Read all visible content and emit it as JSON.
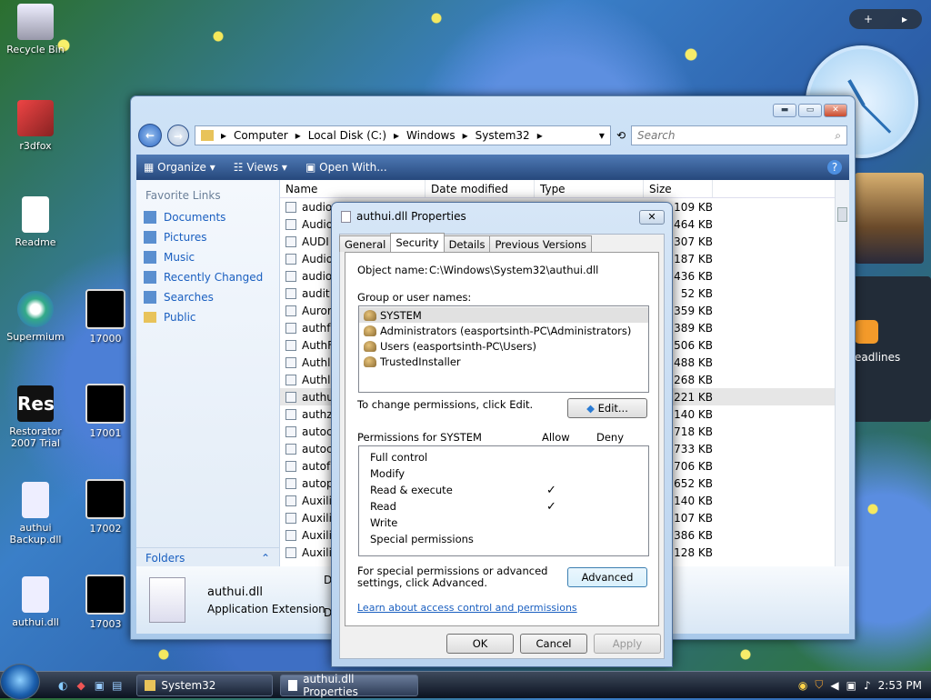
{
  "desktop": {
    "icons": [
      {
        "label": "Recycle Bin"
      },
      {
        "label": "r3dfox"
      },
      {
        "label": "Readme"
      },
      {
        "label": "Supermium"
      },
      {
        "label": "17000"
      },
      {
        "label": "Restorator 2007 Trial"
      },
      {
        "label": "17001"
      },
      {
        "label": "authui Backup.dll"
      },
      {
        "label": "17002"
      },
      {
        "label": "authui.dll"
      },
      {
        "label": "17003"
      }
    ]
  },
  "explorer": {
    "breadcrumb": [
      "Computer",
      "Local Disk (C:)",
      "Windows",
      "System32"
    ],
    "search_placeholder": "Search",
    "toolbar": {
      "organize": "Organize",
      "views": "Views",
      "open_with": "Open With..."
    },
    "favorites_title": "Favorite Links",
    "favorites": [
      "Documents",
      "Pictures",
      "Music",
      "Recently Changed",
      "Searches",
      "Public"
    ],
    "folders": "Folders",
    "columns": {
      "name": "Name",
      "date": "Date modified",
      "type": "Type",
      "size": "Size"
    },
    "files": [
      {
        "name": "audio",
        "size": "109 KB"
      },
      {
        "name": "Audio",
        "size": "464 KB"
      },
      {
        "name": "AUDI",
        "size": "307 KB"
      },
      {
        "name": "Audio",
        "size": "187 KB"
      },
      {
        "name": "audio",
        "size": "436 KB"
      },
      {
        "name": "audit",
        "size": "52 KB"
      },
      {
        "name": "Auror",
        "size": "1,359 KB"
      },
      {
        "name": "authf",
        "size": "389 KB"
      },
      {
        "name": "AuthF",
        "size": "506 KB"
      },
      {
        "name": "Authl",
        "size": "4,488 KB"
      },
      {
        "name": "Authl",
        "size": "268 KB"
      },
      {
        "name": "authu",
        "size": "2,221 KB"
      },
      {
        "name": "authz",
        "size": "140 KB"
      },
      {
        "name": "autoc",
        "size": "718 KB"
      },
      {
        "name": "autoc",
        "size": "733 KB"
      },
      {
        "name": "autof",
        "size": "706 KB"
      },
      {
        "name": "autop",
        "size": "652 KB"
      },
      {
        "name": "Auxili",
        "size": "140 KB"
      },
      {
        "name": "Auxili",
        "size": "107 KB"
      },
      {
        "name": "Auxili",
        "size": "1,386 KB"
      },
      {
        "name": "Auxili",
        "size": "128 KB"
      }
    ],
    "details": {
      "name": "authui.dll",
      "type": "Application Extension",
      "extra": "Da",
      "extra2": "D"
    }
  },
  "dialog": {
    "title": "authui.dll Properties",
    "tabs": [
      "General",
      "Security",
      "Details",
      "Previous Versions"
    ],
    "object_label": "Object name:",
    "object_value": "C:\\Windows\\System32\\authui.dll",
    "group_label": "Group or user names:",
    "users": [
      "SYSTEM",
      "Administrators (easportsinth-PC\\Administrators)",
      "Users (easportsinth-PC\\Users)",
      "TrustedInstaller"
    ],
    "change_text": "To change permissions, click Edit.",
    "edit": "Edit...",
    "perm_label": "Permissions for SYSTEM",
    "allow": "Allow",
    "deny": "Deny",
    "permissions": [
      {
        "name": "Full control",
        "allow": ""
      },
      {
        "name": "Modify",
        "allow": ""
      },
      {
        "name": "Read & execute",
        "allow": "✓"
      },
      {
        "name": "Read",
        "allow": "✓"
      },
      {
        "name": "Write",
        "allow": ""
      },
      {
        "name": "Special permissions",
        "allow": ""
      }
    ],
    "special_text": "For special permissions or advanced settings, click Advanced.",
    "advanced": "Advanced",
    "learn": "Learn about access control and permissions",
    "ok": "OK",
    "cancel": "Cancel",
    "apply": "Apply"
  },
  "gadgets": {
    "headlines": "eadlines"
  },
  "taskbar": {
    "items": [
      "System32",
      "authui.dll Properties"
    ],
    "time": "2:53 PM"
  }
}
